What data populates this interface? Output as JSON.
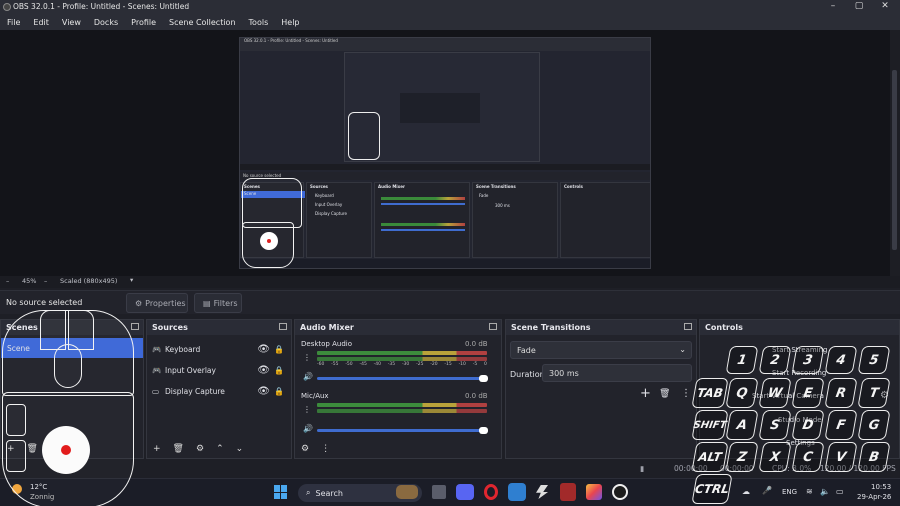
{
  "window": {
    "title": "OBS 32.0.1 - Profile: Untitled - Scenes: Untitled",
    "controls": [
      "–",
      "▢",
      "✕"
    ]
  },
  "menu": [
    "File",
    "Edit",
    "View",
    "Docks",
    "Profile",
    "Scene Collection",
    "Tools",
    "Help"
  ],
  "zoom": {
    "minus": "–",
    "percent": "45%",
    "plus": "–",
    "mode": "Scaled (880x495)",
    "dropdown": "▾"
  },
  "source_bar": {
    "label": "No source selected",
    "properties": "Properties",
    "filters": "Filters"
  },
  "scenes": {
    "title": "Scenes",
    "items": [
      "Scene"
    ]
  },
  "sources": {
    "title": "Sources",
    "items": [
      "Keyboard",
      "Input Overlay",
      "Display Capture"
    ]
  },
  "audio": {
    "title": "Audio Mixer",
    "channels": [
      {
        "name": "Desktop Audio",
        "db": "0.0 dB"
      },
      {
        "name": "Mic/Aux",
        "db": "0.0 dB"
      }
    ],
    "scale": [
      "-60",
      "-55",
      "-50",
      "-45",
      "-40",
      "-35",
      "-30",
      "-25",
      "-20",
      "-15",
      "-10",
      "-5",
      "0"
    ]
  },
  "transitions": {
    "title": "Scene Transitions",
    "type": "Fade",
    "duration_label": "Duration",
    "duration_value": "300 ms"
  },
  "controls": {
    "title": "Controls",
    "buttons": [
      "Start Streaming",
      "Start Recording",
      "Start Virtual Camera",
      "Studio Mode",
      "Settings"
    ]
  },
  "status": {
    "time1": "00:00:00",
    "time2": "00:00:00",
    "cpu": "CPU: 3.0%",
    "fps": "120.00 / 120.00 FPS"
  },
  "keyboard_overlay": {
    "row1": [
      "1",
      "2",
      "3",
      "4",
      "5"
    ],
    "row2": [
      "TAB",
      "Q",
      "W",
      "E",
      "R",
      "T"
    ],
    "row3": [
      "SHIFT",
      "A",
      "S",
      "D",
      "F",
      "G"
    ],
    "row4": [
      "ALT",
      "Z",
      "X",
      "C",
      "V",
      "B"
    ],
    "row5": [
      "CTRL"
    ]
  },
  "taskbar": {
    "weather_temp": "12°C",
    "weather_desc": "Zonnig",
    "search": "Search",
    "lang": "ENG",
    "time": "10:53",
    "date": "29-Apr-26"
  },
  "mini_preview": {
    "title": "OBS 32.0.1 - Profile: Untitled - Scenes: Untitled",
    "label": "No source selected",
    "scenes": "Scenes",
    "scene_item": "Scene",
    "sources": "Sources",
    "source_items": [
      "Keyboard",
      "Input Overlay",
      "Display Capture"
    ],
    "audio": "Audio Mixer",
    "transitions": "Scene Transitions",
    "transition_type": "Fade",
    "duration": "300 ms",
    "controls": "Controls"
  },
  "colors": {
    "accent": "#3d68d8",
    "bg": "#1e1f26",
    "panel": "#22232b"
  }
}
